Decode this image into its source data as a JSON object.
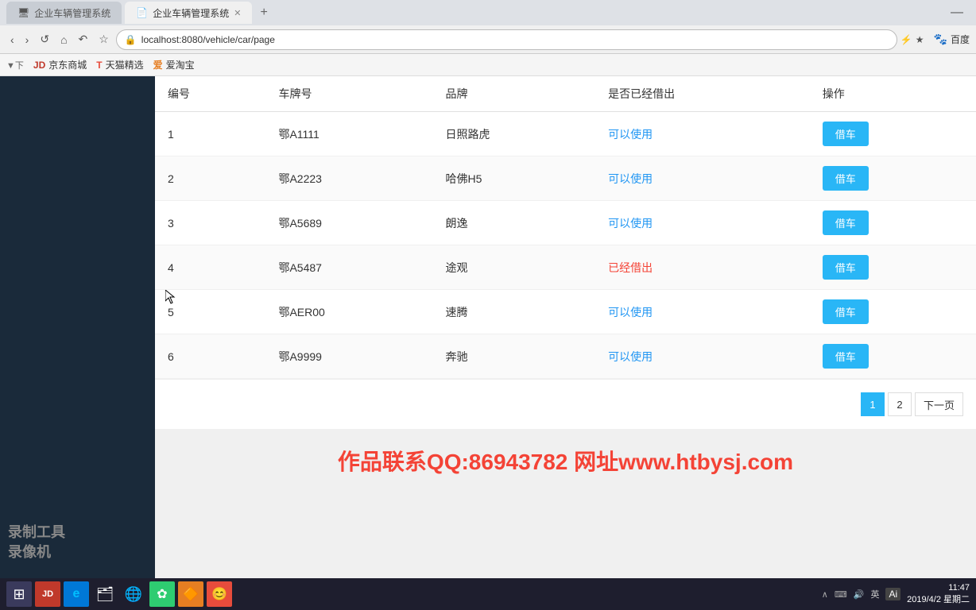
{
  "browser": {
    "tab_inactive_label": "企业车辆管理系统",
    "tab_active_label": "企业车辆管理系统",
    "url": "localhost:8080/vehicle/car/page",
    "minimize_icon": "—",
    "back_icon": "‹",
    "forward_icon": "›",
    "refresh_icon": "↺",
    "home_icon": "⌂",
    "history_icon": "↶",
    "star_icon": "☆",
    "lock_icon": "🔒",
    "lightning_icon": "⚡",
    "star2_icon": "★",
    "baidu_label": "百度"
  },
  "bookmarks": [
    {
      "id": "jd",
      "label": "京东商城",
      "prefix": "下"
    },
    {
      "id": "tmall",
      "label": "天猫精选",
      "prefix": "T"
    },
    {
      "id": "ataobao",
      "label": "爱淘宝",
      "prefix": "爱"
    }
  ],
  "sidebar": {
    "tool_label": "录制工具",
    "recorder_label": "录像机"
  },
  "table": {
    "headers": [
      "编号",
      "车牌号",
      "品牌",
      "是否已经借出",
      "操作"
    ],
    "rows": [
      {
        "id": "1",
        "plate": "鄂A1111",
        "brand": "日照路虎",
        "status": "可以使用",
        "status_type": "available",
        "btn_label": "借车"
      },
      {
        "id": "2",
        "plate": "鄂A2223",
        "brand": "哈佛H5",
        "status": "可以使用",
        "status_type": "available",
        "btn_label": "借车"
      },
      {
        "id": "3",
        "plate": "鄂A5689",
        "brand": "朗逸",
        "status": "可以使用",
        "status_type": "available",
        "btn_label": "借车"
      },
      {
        "id": "4",
        "plate": "鄂A5487",
        "brand": "途观",
        "status": "已经借出",
        "status_type": "borrowed",
        "btn_label": "借车"
      },
      {
        "id": "5",
        "plate": "鄂AER00",
        "brand": "速腾",
        "status": "可以使用",
        "status_type": "available",
        "btn_label": "借车"
      },
      {
        "id": "6",
        "plate": "鄂A9999",
        "brand": "奔驰",
        "status": "可以使用",
        "status_type": "available",
        "btn_label": "借车"
      }
    ]
  },
  "pagination": {
    "page1_label": "1",
    "page2_label": "2",
    "next_label": "下一页",
    "active_page": 1
  },
  "footer": {
    "watermark": "作品联系QQ:86943782  网址www.htbysj.com"
  },
  "taskbar": {
    "time": "11:47",
    "date": "2019/4/2 星期二",
    "lang": "英",
    "ai_label": "Ai",
    "icons": [
      {
        "id": "start",
        "symbol": "⊞"
      },
      {
        "id": "jd",
        "symbol": "JD"
      },
      {
        "id": "edge",
        "symbol": "e"
      },
      {
        "id": "folder",
        "symbol": "📁"
      },
      {
        "id": "chrome",
        "symbol": "●"
      },
      {
        "id": "app1",
        "symbol": "✿"
      },
      {
        "id": "app2",
        "symbol": "🔶"
      },
      {
        "id": "app3",
        "symbol": "😊"
      }
    ]
  }
}
